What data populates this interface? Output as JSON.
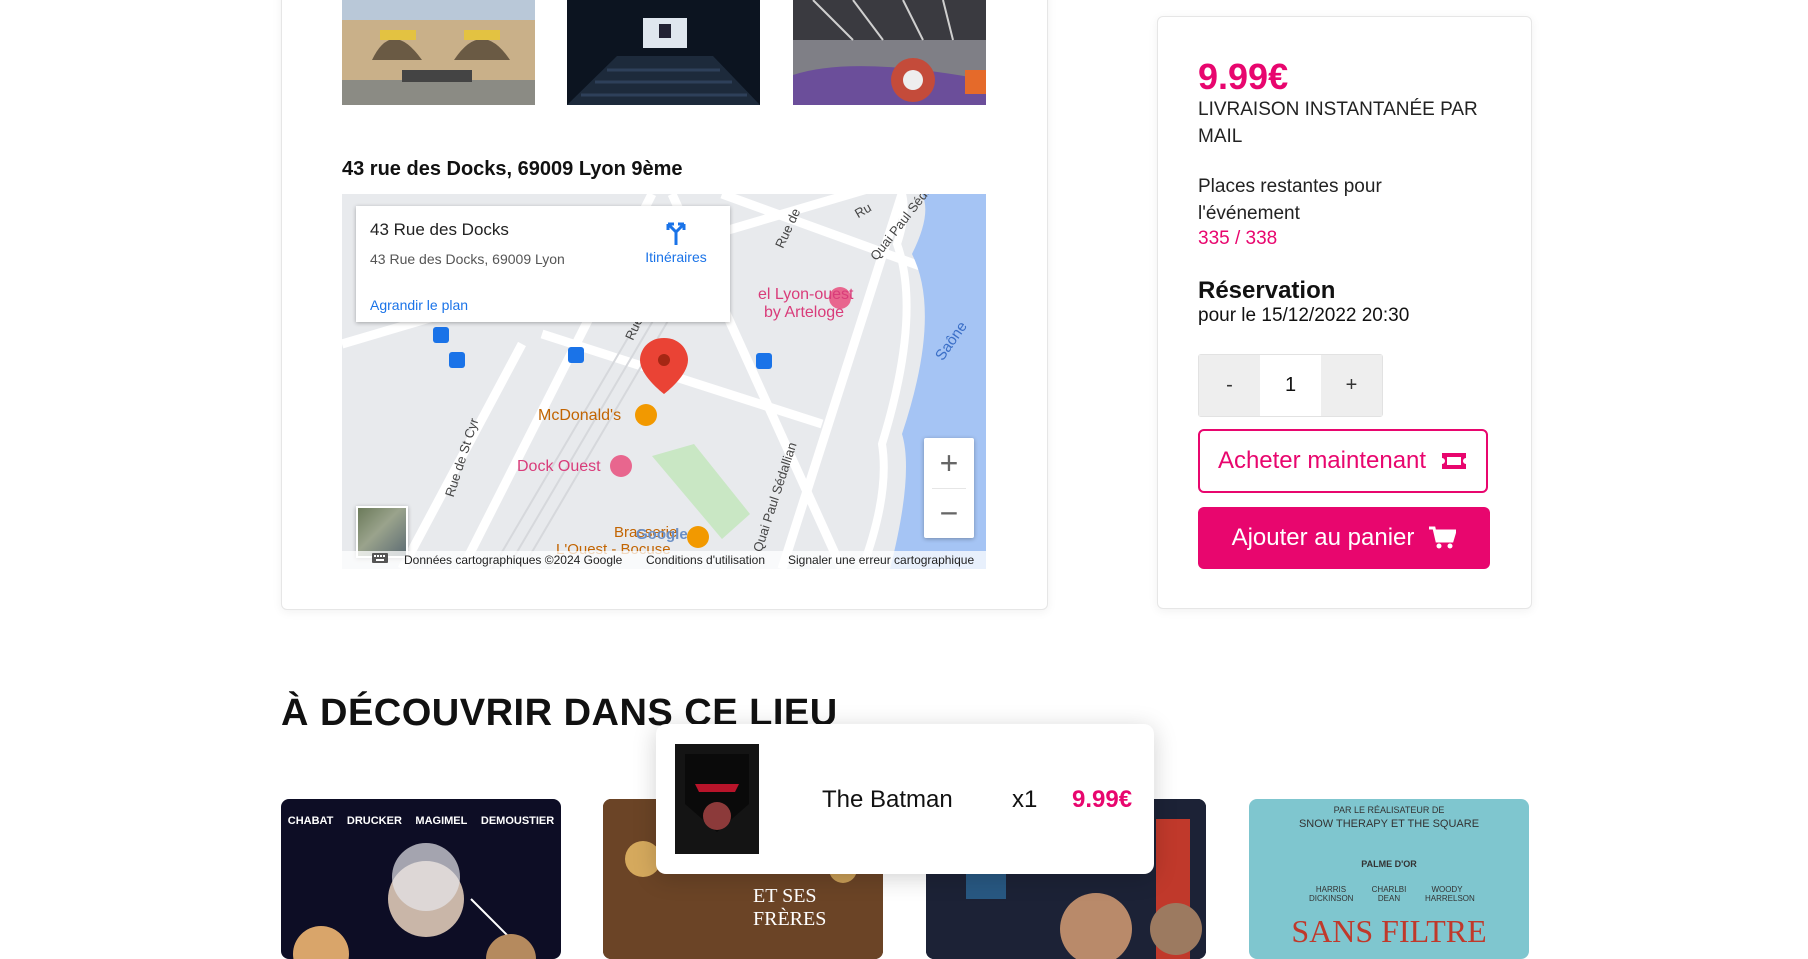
{
  "venue": {
    "address": "43 rue des Docks, 69009 Lyon 9ème"
  },
  "map": {
    "info_title": "43 Rue des Docks",
    "info_address": "43 Rue des Docks, 69009 Lyon",
    "directions_label": "Itinéraires",
    "enlarge_label": "Agrandir le plan",
    "labels": {
      "lyon_ouest": "el Lyon-ouest",
      "by_arteloge": "by Arteloge",
      "mcdonalds": "McDonald's",
      "dock_ouest": "Dock Ouest",
      "brasserie": "Brasserie",
      "louest_bocuse": "L'Ouest - Bocuse",
      "quai_sedallian_1": "Quai Paul Sédallian",
      "quai_sedallian_2": "Quai Paul Sédallian",
      "rue_st_cyr": "Rue de St Cyr",
      "saone": "Saône",
      "rue_de": "Rue de",
      "rue": "Rue",
      "ru": "Ru"
    },
    "zoom_in": "+",
    "zoom_out": "−",
    "google_logo": "Google",
    "attribution": {
      "data": "Données cartographiques ©2024 Google",
      "terms": "Conditions d'utilisation",
      "report": "Signaler une erreur cartographique"
    }
  },
  "purchase": {
    "price": "9.99€",
    "delivery": "LIVRAISON INSTANTANÉE PAR MAIL",
    "places_label": "Places restantes pour l'événement",
    "places_value": "335 / 338",
    "reservation_title": "Réservation",
    "reservation_date": "pour le 15/12/2022 20:30",
    "qty_minus": "-",
    "qty_value": "1",
    "qty_plus": "+",
    "buy_label": "Acheter maintenant",
    "cart_label": "Ajouter au panier"
  },
  "discover": {
    "title": "À DÉCOUVRIR DANS CE LIEU",
    "poster1_names": [
      "CHABAT",
      "DRUCKER",
      "MAGIMEL",
      "DEMOUSTIER"
    ],
    "poster2_title": "ET SES FRÈRES",
    "poster4_top": "PAR LE RÉALISATEUR DE",
    "poster4_sub": "SNOW THERAPY ET THE SQUARE",
    "poster4_award": "PALME D'OR",
    "poster4_actors": [
      "HARRIS DICKINSON",
      "CHARLBI DEAN",
      "WOODY HARRELSON"
    ],
    "poster4_title": "SANS FILTRE"
  },
  "cart_popup": {
    "name": "The Batman",
    "qty": "x1",
    "price": "9.99€"
  },
  "colors": {
    "accent": "#e8066e",
    "map_water": "#a5c4f4",
    "map_land": "#e8eaed"
  }
}
